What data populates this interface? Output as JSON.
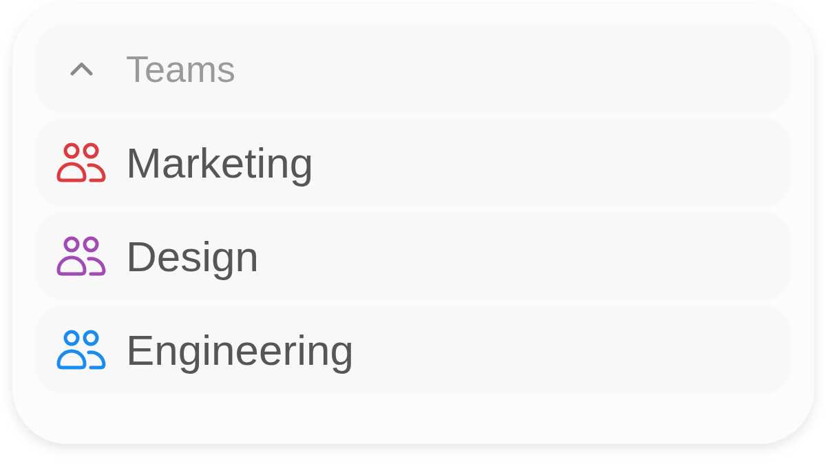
{
  "group": {
    "label": "Teams",
    "expanded": true
  },
  "teams": [
    {
      "name": "Marketing",
      "color": "#dc3c3f"
    },
    {
      "name": "Design",
      "color": "#a24bb4"
    },
    {
      "name": "Engineering",
      "color": "#1a8cf0"
    }
  ]
}
